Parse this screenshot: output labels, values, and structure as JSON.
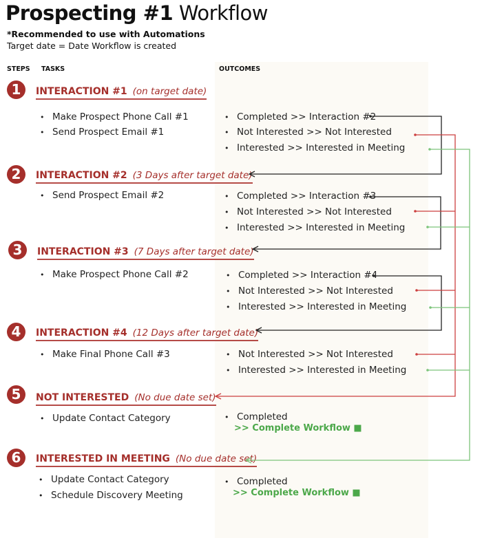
{
  "header": {
    "title_bold": "Prospecting #1",
    "title_light": "Workflow",
    "note": "*Recommended to use with Automations",
    "target_note": "Target date = Date Workflow is created"
  },
  "columns": {
    "steps": "STEPS",
    "tasks": "TASKS",
    "outcomes": "OUTCOMES"
  },
  "colors": {
    "accent_red": "#a52f2b",
    "line_red": "#cc3f3f",
    "line_green": "#7cc47a",
    "line_black": "#222222",
    "complete_green": "#4ca84a",
    "panel_bg": "#fcfaf5"
  },
  "steps": [
    {
      "number": "1",
      "name": "INTERACTION #1",
      "when": "(on target date)",
      "tasks": [
        "Make Prospect Phone Call #1",
        "Send Prospect Email #1"
      ],
      "outcomes": [
        "Completed >> Interaction #2",
        "Not Interested >> Not Interested",
        "Interested >> Interested in Meeting"
      ]
    },
    {
      "number": "2",
      "name": "INTERACTION #2",
      "when": "(3 Days after target date)",
      "tasks": [
        "Send Prospect Email #2"
      ],
      "outcomes": [
        "Completed >> Interaction #3",
        "Not Interested >> Not Interested",
        "Interested >> Interested in Meeting"
      ]
    },
    {
      "number": "3",
      "name": "INTERACTION #3",
      "when": "(7 Days after target date)",
      "tasks": [
        "Make Prospect Phone Call #2"
      ],
      "outcomes": [
        "Completed >> Interaction #4",
        "Not Interested >> Not Interested",
        "Interested >> Interested in Meeting"
      ]
    },
    {
      "number": "4",
      "name": "INTERACTION #4",
      "when": "(12 Days after target date)",
      "tasks": [
        "Make Final Phone Call #3"
      ],
      "outcomes": [
        "Not Interested >> Not Interested",
        "Interested >> Interested in Meeting"
      ]
    },
    {
      "number": "5",
      "name": "NOT INTERESTED",
      "when": "(No due date set)",
      "tasks": [
        "Update Contact Category"
      ],
      "outcomes": [
        "Completed"
      ],
      "complete": ">> Complete Workflow ■"
    },
    {
      "number": "6",
      "name": "INTERESTED IN MEETING",
      "when": "(No due date set)",
      "tasks": [
        "Update Contact Category",
        "Schedule Discovery Meeting"
      ],
      "outcomes": [
        "Completed"
      ],
      "complete": ">> Complete Workflow ■"
    }
  ]
}
